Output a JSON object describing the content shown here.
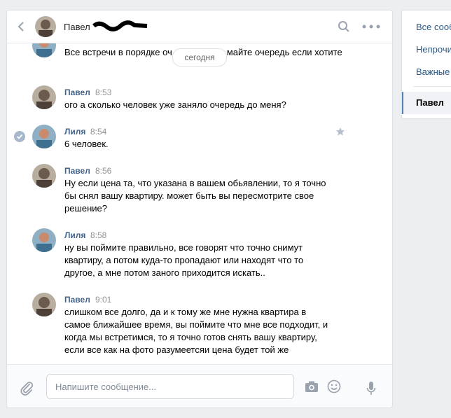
{
  "header": {
    "contact_name": "Павел"
  },
  "date_divider": "сегодня",
  "messages": [
    {
      "id": "m0",
      "name": "",
      "time": "",
      "text": "Все встречи в порядке оч",
      "text2": "майте очередь если хотите"
    },
    {
      "id": "m1",
      "name": "Павел",
      "time": "8:53",
      "text": "ого а сколько человек уже заняло очередь до меня?"
    },
    {
      "id": "m2",
      "name": "Лиля",
      "time": "8:54",
      "text": "6 человек."
    },
    {
      "id": "m3",
      "name": "Павел",
      "time": "8:56",
      "text": "Ну если цена та, что указана в вашем обьявлении, то я точно бы снял вашу квартиру. может быть вы пересмотрите свое решение?"
    },
    {
      "id": "m4",
      "name": "Лиля",
      "time": "8:58",
      "text": "ну вы поймите правильно, все говорят что точно снимут квартиру, а потом куда-то пропадают или находят что то другое, а мне потом заного приходится искать.."
    },
    {
      "id": "m5",
      "name": "Павел",
      "time": "9:01",
      "text": "слишком все долго, да и к тому же мне нужна квартира в самое ближайшее время, вы поймите что мне все подходит, и когда мы встретимся, то я точно готов снять вашу квартиру, если все как на фото разумеетсяи цена будет той же"
    }
  ],
  "composer": {
    "placeholder": "Напишите сообщение..."
  },
  "right_panel": {
    "items": [
      "Все сооб",
      "Непрочи",
      "Важные"
    ],
    "active": "Павел"
  },
  "colors": {
    "link": "#42648b",
    "accent": "#5181b8",
    "background": "#edeef0"
  }
}
